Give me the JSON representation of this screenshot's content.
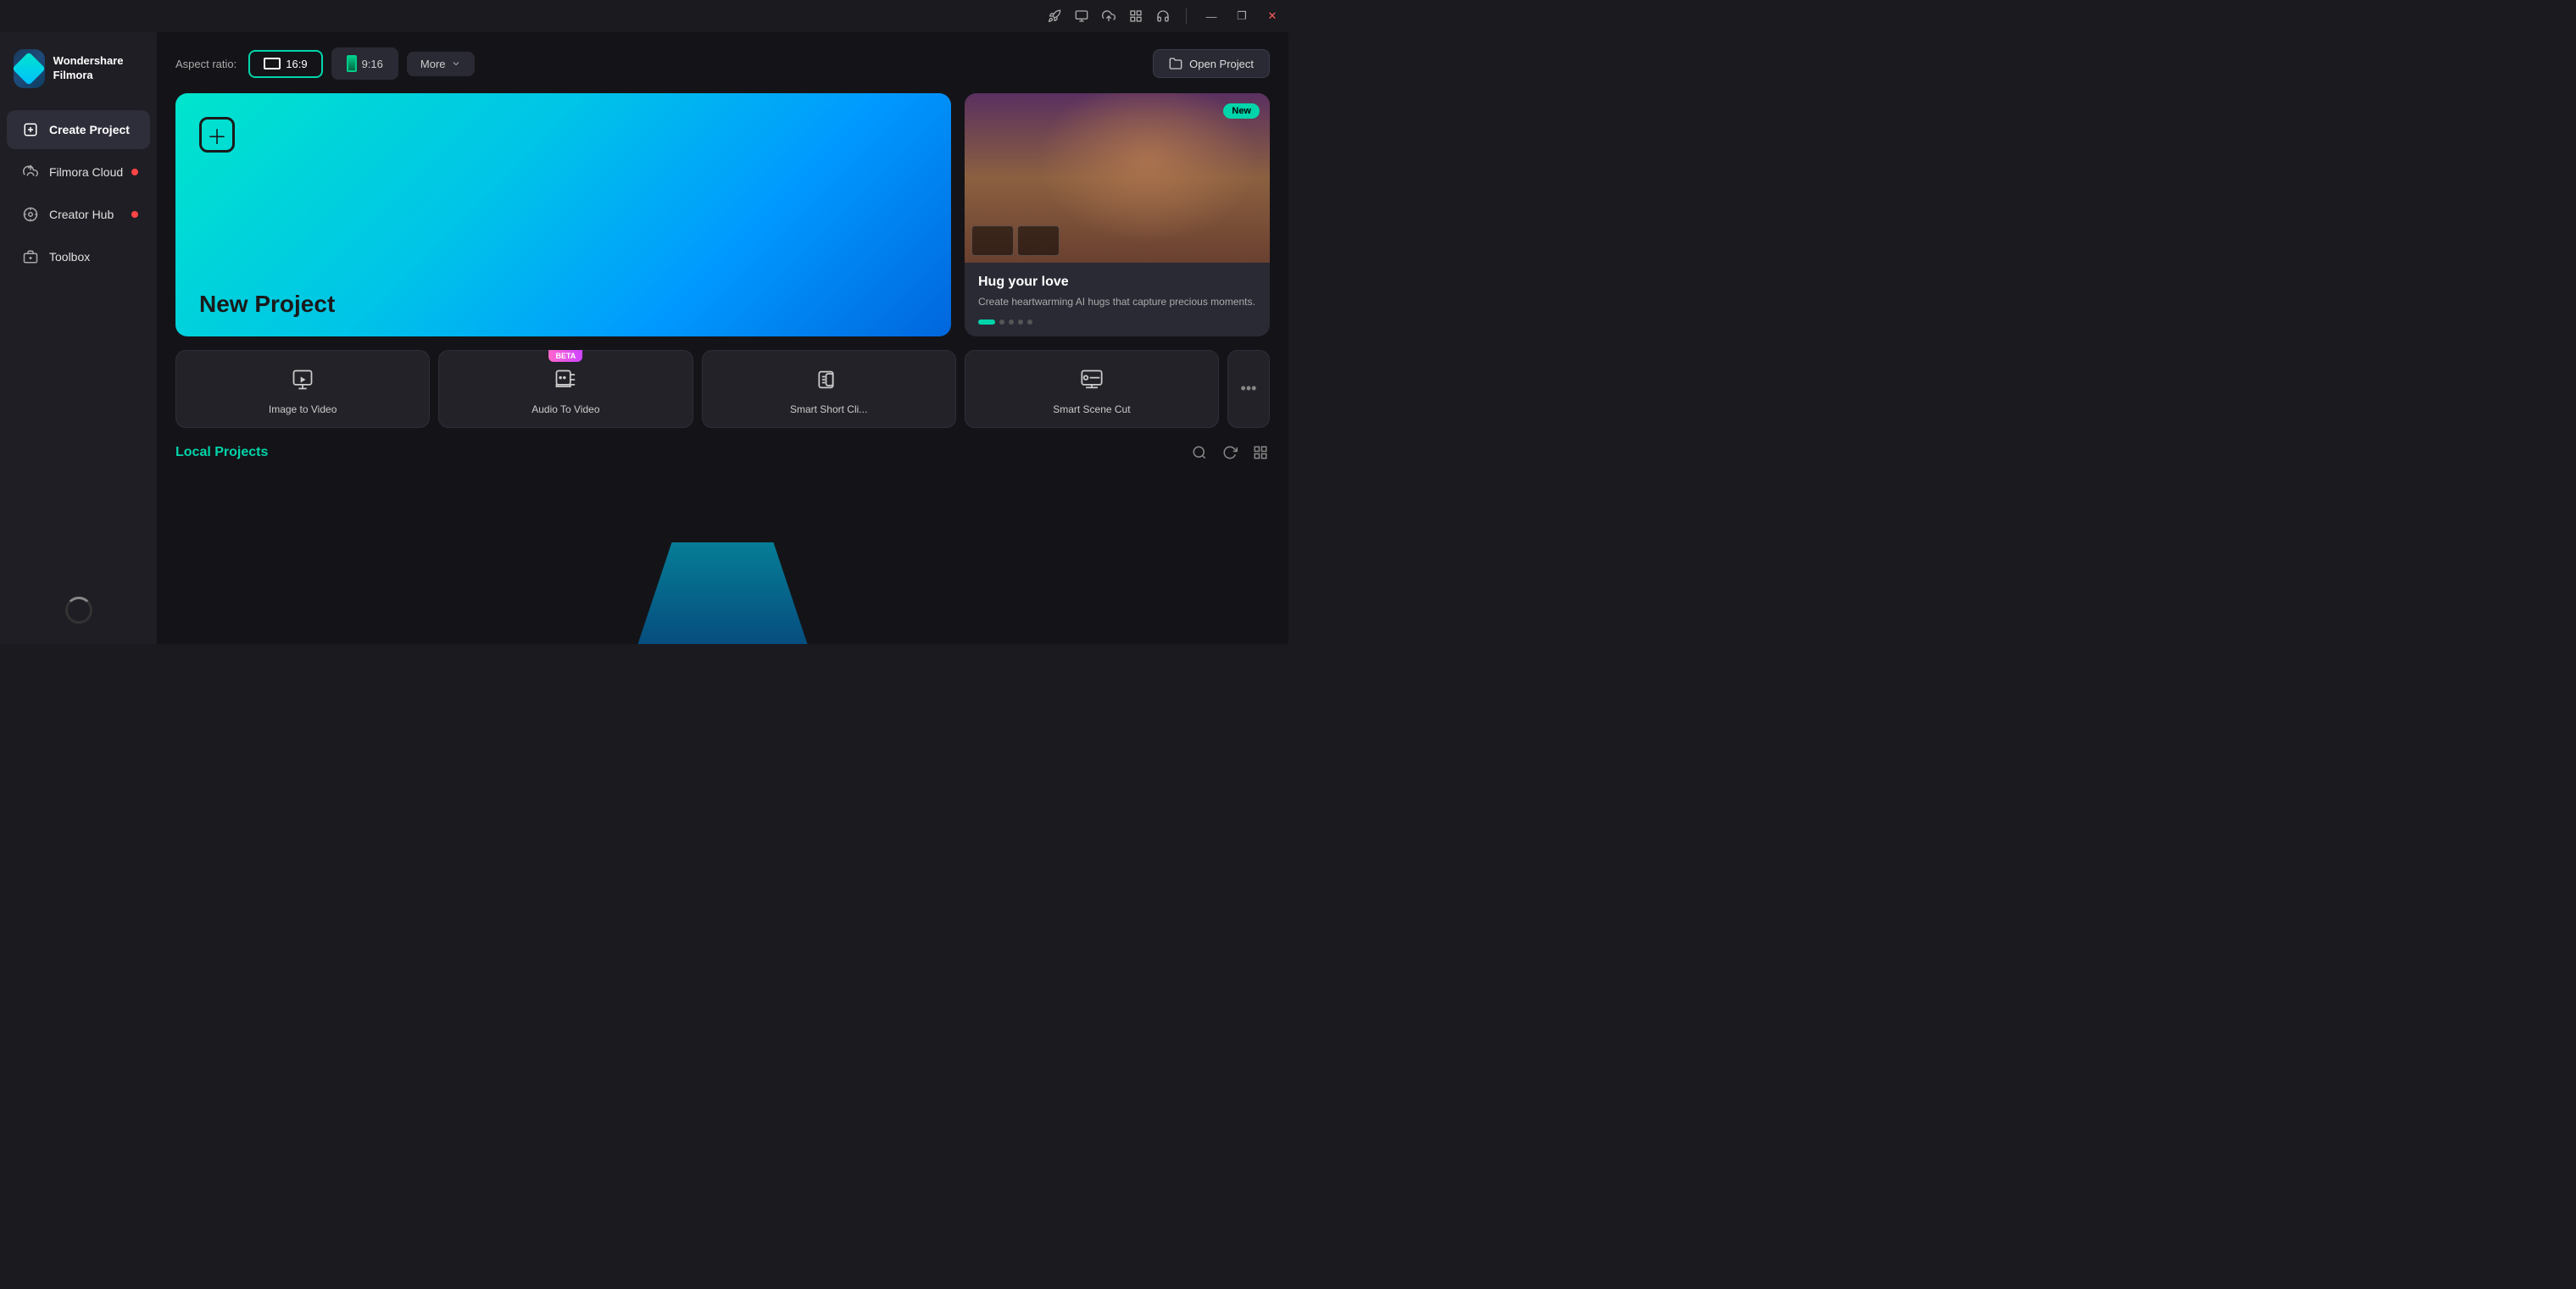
{
  "app": {
    "name": "Wondershare Filmora"
  },
  "titlebar": {
    "icons": [
      "rocket",
      "screen-record",
      "cloud-upload",
      "grid-layout",
      "headset"
    ],
    "minimize_label": "—",
    "maximize_label": "❐",
    "close_label": "✕"
  },
  "sidebar": {
    "logo_line1": "Wondershare",
    "logo_line2": "Filmora",
    "items": [
      {
        "id": "create-project",
        "label": "Create Project",
        "active": true,
        "dot": false
      },
      {
        "id": "filmora-cloud",
        "label": "Filmora Cloud",
        "active": false,
        "dot": true
      },
      {
        "id": "creator-hub",
        "label": "Creator Hub",
        "active": false,
        "dot": true
      },
      {
        "id": "toolbox",
        "label": "Toolbox",
        "active": false,
        "dot": false
      }
    ]
  },
  "top_controls": {
    "aspect_ratio_label": "Aspect ratio:",
    "aspect_16_9": "16:9",
    "aspect_9_16": "9:16",
    "more_label": "More",
    "open_project_label": "Open Project"
  },
  "new_project": {
    "title": "New Project"
  },
  "featured": {
    "badge": "New",
    "title": "Hug your love",
    "description": "Create heartwarming AI hugs that capture precious moments."
  },
  "tools": [
    {
      "id": "image-to-video",
      "label": "Image to Video",
      "beta": false
    },
    {
      "id": "audio-to-video",
      "label": "Audio To Video",
      "beta": true
    },
    {
      "id": "smart-short-clip",
      "label": "Smart Short Cli...",
      "beta": false
    },
    {
      "id": "smart-scene-cut",
      "label": "Smart Scene Cut",
      "beta": false
    }
  ],
  "more_tools_label": "•••",
  "local_projects": {
    "title": "Local Projects"
  }
}
